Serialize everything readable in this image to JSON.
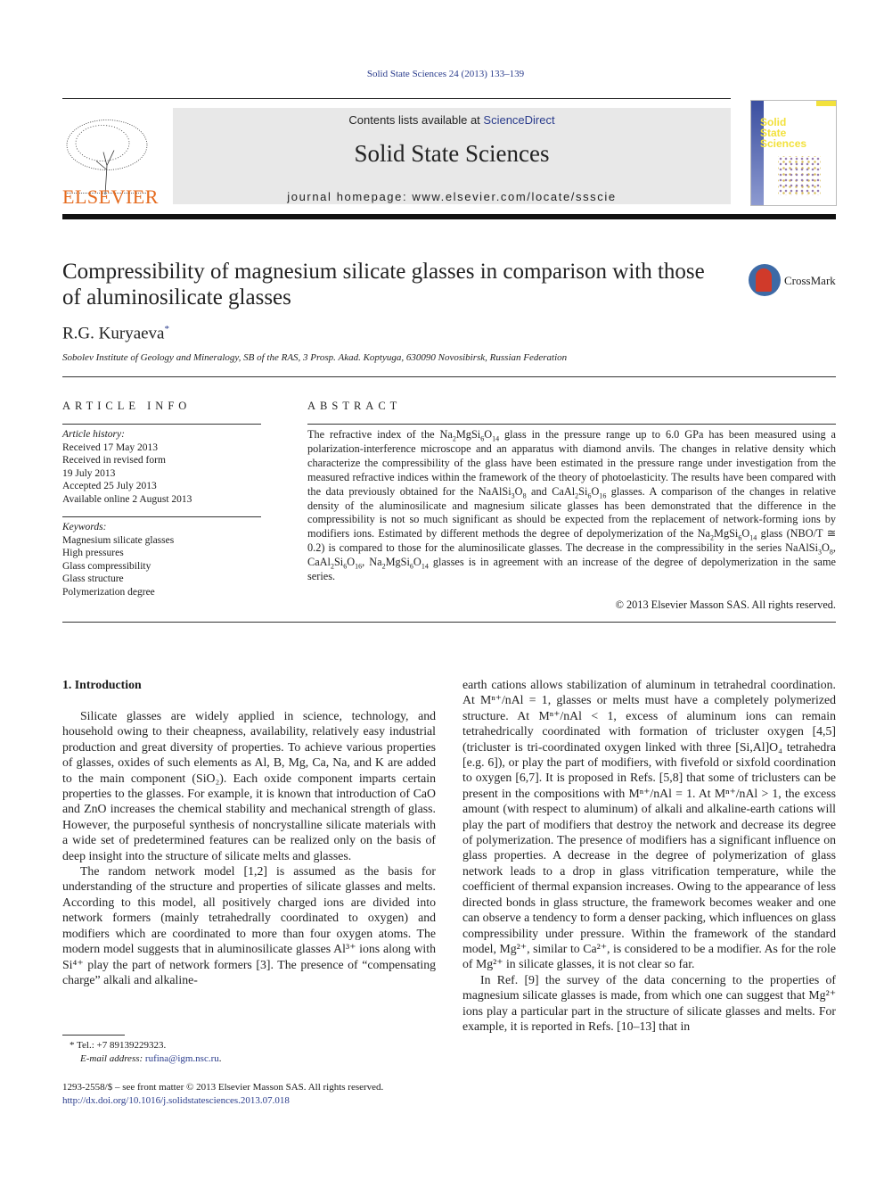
{
  "header": {
    "journal_ref": "Solid State Sciences 24 (2013) 133–139",
    "contents_prefix": "Contents lists available at ",
    "contents_link": "ScienceDirect",
    "journal_title": "Solid State Sciences",
    "homepage": "journal homepage: www.elsevier.com/locate/ssscie",
    "publisher_logo": "ELSEVIER",
    "cover_title": [
      "Solid",
      "State",
      "Sciences"
    ],
    "crossmark_label": "CrossMark",
    "colors": {
      "link": "#2a3c8c",
      "elsevier_orange": "#e56a1e",
      "banner_bg": "#e8e8e8"
    }
  },
  "article": {
    "title": "Compressibility of magnesium silicate glasses in comparison with those of aluminosilicate glasses",
    "author": "R.G. Kuryaeva",
    "author_mark": "*",
    "affiliation": "Sobolev Institute of Geology and Mineralogy, SB of the RAS, 3 Prosp. Akad. Koptyuga, 630090 Novosibirsk, Russian Federation"
  },
  "article_info": {
    "label": "ARTICLE INFO",
    "history_label": "Article history:",
    "history": [
      "Received 17 May 2013",
      "Received in revised form",
      "19 July 2013",
      "Accepted 25 July 2013",
      "Available online 2 August 2013"
    ],
    "keywords_label": "Keywords:",
    "keywords": [
      "Magnesium silicate glasses",
      "High pressures",
      "Glass compressibility",
      "Glass structure",
      "Polymerization degree"
    ]
  },
  "abstract": {
    "label": "ABSTRACT",
    "parts": [
      "The refractive index of the Na",
      "2",
      "MgSi",
      "6",
      "O",
      "14",
      " glass in the pressure range up to 6.0 GPa has been measured using a polarization-interference microscope and an apparatus with diamond anvils. The changes in relative density which characterize the compressibility of the glass have been estimated in the pressure range under investigation from the measured refractive indices within the framework of the theory of photoelasticity. The results have been compared with the data previously obtained for the NaAlSi",
      "3",
      "O",
      "8",
      " and CaAl",
      "2",
      "Si",
      "6",
      "O",
      "16",
      " glasses. A comparison of the changes in relative density of the aluminosilicate and magnesium silicate glasses has been demonstrated that the difference in the compressibility is not so much significant as should be expected from the replacement of network-forming ions by modifiers ions. Estimated by different methods the degree of depolymerization of the Na",
      "2",
      "MgSi",
      "6",
      "O",
      "14",
      " glass (NBO/T ≅ 0.2) is compared to those for the aluminosilicate glasses. The decrease in the compressibility in the series NaAlSi",
      "3",
      "O",
      "8",
      ", CaAl",
      "2",
      "Si",
      "6",
      "O",
      "16",
      ", Na",
      "2",
      "MgSi",
      "6",
      "O",
      "14",
      " glasses is in agreement with an increase of the degree of depolymerization in the same series."
    ],
    "copyright": "© 2013 Elsevier Masson SAS. All rights reserved."
  },
  "body": {
    "intro_heading": "1.  Introduction",
    "left_paragraphs": [
      "Silicate glasses are widely applied in science, technology, and household owing to their cheapness, availability, relatively easy industrial production and great diversity of properties. To achieve various properties of glasses, oxides of such elements as Al, B, Mg, Ca, Na, and K are added to the main component (SiO₂). Each oxide component imparts certain properties to the glasses. For example, it is known that introduction of CaO and ZnO increases the chemical stability and mechanical strength of glass. However, the purposeful synthesis of noncrystalline silicate materials with a wide set of predetermined features can be realized only on the basis of deep insight into the structure of silicate melts and glasses.",
      "The random network model [1,2] is assumed as the basis for understanding of the structure and properties of silicate glasses and melts. According to this model, all positively charged ions are divided into network formers (mainly tetrahedrally coordinated to oxygen) and modifiers which are coordinated to more than four oxygen atoms. The modern model suggests that in aluminosilicate glasses Al³⁺ ions along with Si⁴⁺ play the part of network formers [3]. The presence of “compensating charge” alkali and alkaline-"
    ],
    "right_paragraphs": [
      "earth cations allows stabilization of aluminum in tetrahedral coordination. At Mⁿ⁺/nAl = 1, glasses or melts must have a completely polymerized structure. At Mⁿ⁺/nAl < 1, excess of aluminum ions can remain tetrahedrically coordinated with formation of tricluster oxygen [4,5] (tricluster is tri-coordinated oxygen linked with three [Si,Al]O₄ tetrahedra [e.g. 6]), or play the part of modifiers, with fivefold or sixfold coordination to oxygen [6,7]. It is proposed in Refs. [5,8] that some of triclusters can be present in the compositions with Mⁿ⁺/nAl = 1. At Mⁿ⁺/nAl > 1, the excess amount (with respect to aluminum) of alkali and alkaline-earth cations will play the part of modifiers that destroy the network and decrease its degree of polymerization. The presence of modifiers has a significant influence on glass properties. A decrease in the degree of polymerization of glass network leads to a drop in glass vitrification temperature, while the coefficient of thermal expansion increases. Owing to the appearance of less directed bonds in glass structure, the framework becomes weaker and one can observe a tendency to form a denser packing, which influences on glass compressibility under pressure. Within the framework of the standard model, Mg²⁺, similar to Ca²⁺, is considered to be a modifier. As for the role of Mg²⁺ in silicate glasses, it is not clear so far.",
      "In Ref. [9] the survey of the data concerning to the properties of magnesium silicate glasses is made, from which one can suggest that Mg²⁺ ions play a particular part in the structure of silicate glasses and melts. For example, it is reported in Refs. [10–13] that in"
    ]
  },
  "footnote": {
    "tel": "* Tel.: +7 89139229323.",
    "email_label": "E-mail address: ",
    "email": "rufina@igm.nsc.ru",
    "email_suffix": "."
  },
  "front_matter": {
    "issn_line": "1293-2558/$ – see front matter © 2013 Elsevier Masson SAS. All rights reserved.",
    "doi": "http://dx.doi.org/10.1016/j.solidstatesciences.2013.07.018"
  }
}
